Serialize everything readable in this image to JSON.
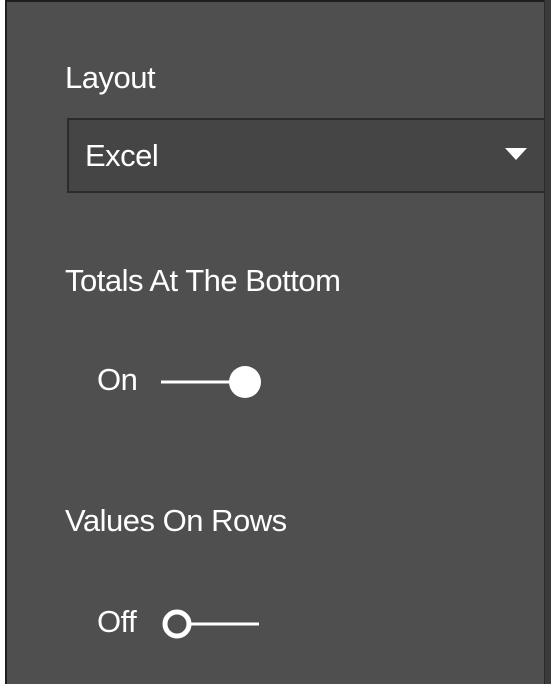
{
  "layout": {
    "label": "Layout",
    "dropdown": {
      "selected": "Excel",
      "icon": "chevron-down-icon"
    }
  },
  "totals_at_bottom": {
    "label": "Totals At The Bottom",
    "state_text": "On",
    "value": true
  },
  "values_on_rows": {
    "label": "Values On Rows",
    "state_text": "Off",
    "value": false
  },
  "colors": {
    "panel": "#4f4f4f",
    "dropdown": "#454545",
    "text": "#ffffff",
    "border": "#2b2b2b"
  }
}
